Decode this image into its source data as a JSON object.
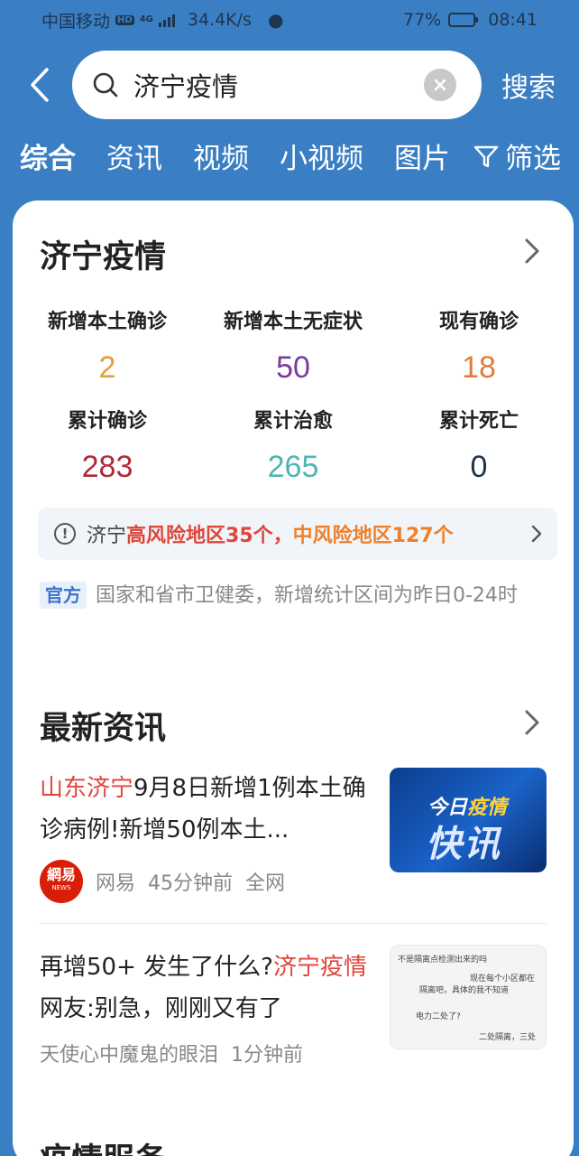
{
  "status_bar": {
    "carrier": "中国移动",
    "hd": "HD",
    "network": "4G",
    "speed": "34.4K/s",
    "battery": "77%",
    "battery_level": 0.77,
    "time": "08:41"
  },
  "search": {
    "query": "济宁疫情",
    "submit_label": "搜索"
  },
  "tabs": [
    "综合",
    "资讯",
    "视频",
    "小视频",
    "图片"
  ],
  "filter_label": "筛选",
  "epidemic": {
    "title": "济宁疫情",
    "stats": [
      {
        "label": "新增本土确诊",
        "value": "2",
        "color": "#e0a13a"
      },
      {
        "label": "新增本土无症状",
        "value": "50",
        "color": "#7a3c9b"
      },
      {
        "label": "现有确诊",
        "value": "18",
        "color": "#e07d3a"
      },
      {
        "label": "累计确诊",
        "value": "283",
        "color": "#b02a37"
      },
      {
        "label": "累计治愈",
        "value": "265",
        "color": "#4fb5b3"
      },
      {
        "label": "累计死亡",
        "value": "0",
        "color": "#1f3347"
      }
    ],
    "risk_prefix": "济宁",
    "risk_high": "高风险地区35个，",
    "risk_mid": "中风险地区127个",
    "source_tag": "官方",
    "source_text": "国家和省市卫健委，新增统计区间为昨日0-24时"
  },
  "latest_news": {
    "title": "最新资讯",
    "items": [
      {
        "title_hl": "山东济宁",
        "title_rest": "9月8日新增1例本土确诊病例!新增50例本土...",
        "logo_text": "網易",
        "logo_sub": "NEWS",
        "source": "网易",
        "time": "45分钟前",
        "scope": "全网",
        "thumb_line1": "今日",
        "thumb_line1b": "疫情",
        "thumb_line2": "快讯"
      },
      {
        "title_pre": "再增50+ 发生了什么?",
        "title_hl": "济宁疫情",
        "title_rest": " 网友:别急，刚刚又有了",
        "source": "天使心中魔鬼的眼泪",
        "time": "1分钟前",
        "thumb_line1": "不是隔离点检测出来的吗",
        "thumb_line2": "现在每个小区都在",
        "thumb_line3": "隔离吧，具体的我不知道",
        "thumb_line4": "电力二处",
        "thumb_line5": "了?",
        "thumb_line6": "二处隔离，三处"
      }
    ]
  },
  "services": {
    "title": "疫情服务"
  }
}
